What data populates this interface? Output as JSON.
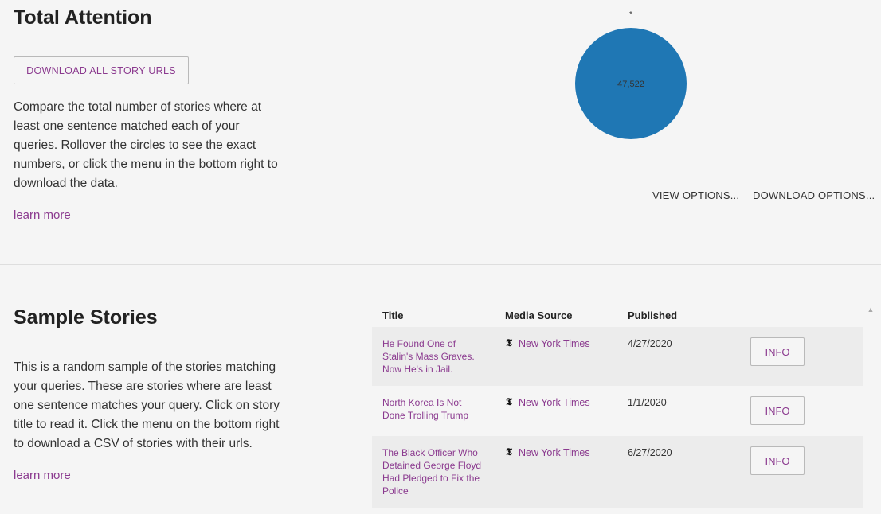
{
  "attention": {
    "title": "Total Attention",
    "download_button": "DOWNLOAD ALL STORY URLS",
    "description": "Compare the total number of stories where at least one sentence matched each of your queries. Rollover the circles to see the exact numbers, or click the menu in the bottom right to download the data.",
    "learn_more": "learn more",
    "chart_data": {
      "type": "bubble",
      "series": [
        {
          "name": "*",
          "value": 47522,
          "label": "47,522",
          "color": "#1f77b4"
        }
      ]
    },
    "view_options": "VIEW OPTIONS...",
    "download_options": "DOWNLOAD OPTIONS..."
  },
  "stories": {
    "title": "Sample Stories",
    "description": "This is a random sample of the stories matching your queries. These are stories where are least one sentence matches your query. Click on story title to read it. Click the menu on the bottom right to download a CSV of stories with their urls.",
    "learn_more": "learn more",
    "columns": [
      "Title",
      "Media Source",
      "Published"
    ],
    "rows": [
      {
        "title": "He Found One of Stalin's Mass Graves. Now He's in Jail.",
        "source": "New York Times",
        "published": "4/27/2020",
        "info": "INFO"
      },
      {
        "title": "North Korea Is Not Done Trolling Trump",
        "source": "New York Times",
        "published": "1/1/2020",
        "info": "INFO"
      },
      {
        "title": "The Black Officer Who Detained George Floyd Had Pledged to Fix the Police",
        "source": "New York Times",
        "published": "6/27/2020",
        "info": "INFO"
      }
    ],
    "source_icon_glyph": "𝕿"
  }
}
